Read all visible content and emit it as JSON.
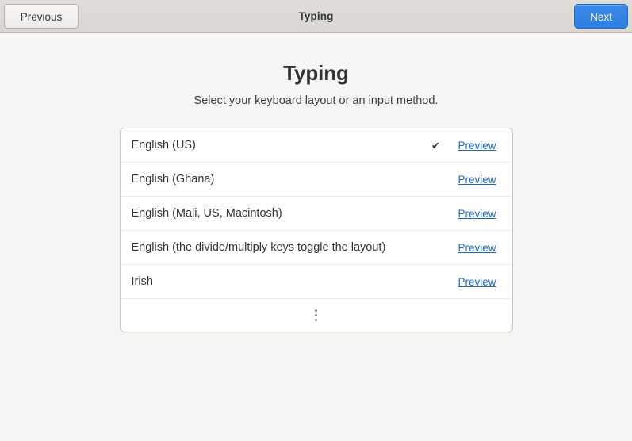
{
  "headerbar": {
    "title": "Typing",
    "previous_label": "Previous",
    "next_label": "Next"
  },
  "page": {
    "title": "Typing",
    "subtitle": "Select your keyboard layout or an input method."
  },
  "layout_list": {
    "preview_label": "Preview",
    "check_glyph": "✔",
    "more_icon": "more-vertical-icon",
    "rows": [
      {
        "name": "English (US)",
        "selected": true
      },
      {
        "name": "English (Ghana)",
        "selected": false
      },
      {
        "name": "English (Mali, US, Macintosh)",
        "selected": false
      },
      {
        "name": "English (the divide/multiply keys toggle the layout)",
        "selected": false
      },
      {
        "name": "Irish",
        "selected": false
      }
    ]
  },
  "colors": {
    "accent": "#3c8ae8",
    "link": "#1b6acb",
    "headerbar_bg": "#dedbd7",
    "page_bg": "#f6f5f4",
    "list_bg": "#ffffff",
    "list_border": "#cdc7c2",
    "text": "#2e3436"
  }
}
